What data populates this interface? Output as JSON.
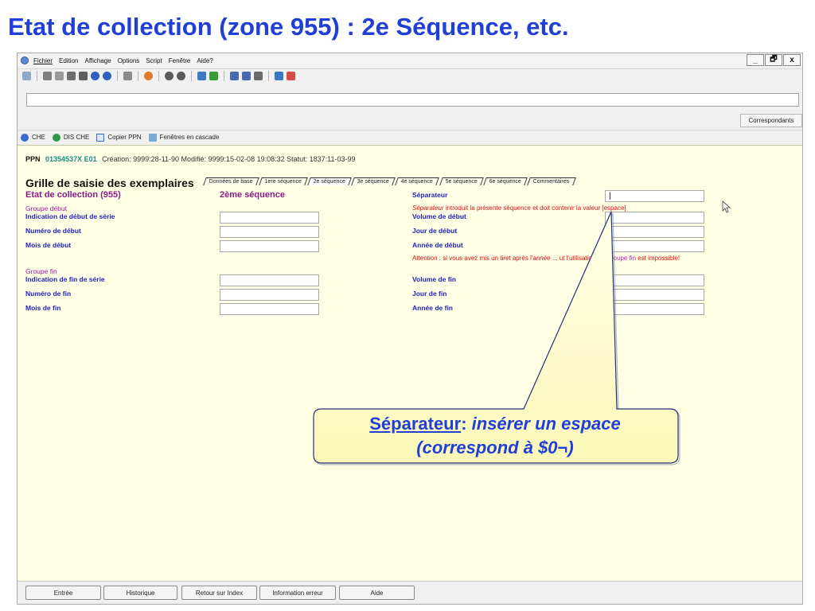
{
  "slide": {
    "title": "Etat de collection (zone 955) :  2e Séquence, etc."
  },
  "menubar": {
    "items": [
      "Fichier",
      "Edition",
      "Affichage",
      "Options",
      "Script",
      "Fenêtre",
      "Aide?"
    ],
    "window_controls": [
      "_",
      "🗗",
      "x"
    ]
  },
  "toolbar": {
    "icons": [
      "print-icon",
      "cut-icon",
      "copy-icon",
      "paste-icon",
      "save-icon",
      "undo-icon",
      "redo-icon",
      "doc-icon",
      "star-icon",
      "back-icon",
      "forward-icon",
      "filter-icon",
      "triangle-icon",
      "code-icon",
      "list-icon",
      "page-icon",
      "upload-icon",
      "arrow-icon"
    ]
  },
  "command_bar": {
    "value": ""
  },
  "correspondants_label": "Correspondants",
  "tabs": [
    {
      "label": "CHE",
      "icon": "help-icon"
    },
    {
      "label": "DIS CHE",
      "icon": "globe-icon"
    },
    {
      "label": "Copier PPN",
      "icon": "check-icon"
    },
    {
      "label": "Fenêtres en cascade",
      "icon": "cascade-icon"
    }
  ],
  "record": {
    "ppn_label": "PPN",
    "ppn_id": "01354537X E01",
    "rest": "Création: 9999:28-11-90 Modifié: 9999:15-02-08 19:08:32 Statut: 1837:11-03-99"
  },
  "form": {
    "title": "Grille de saisie des exemplaires",
    "seq_tabs": [
      "Données de base",
      "1ere séquence",
      "2e séquence",
      "3e séquence",
      "4e séquence",
      "5e séquence",
      "6e séquence",
      "Commentaires"
    ],
    "active_tab": "2e séquence",
    "section_title": "Etat de collection (955)",
    "sequence_title": "2ème séquence",
    "separator_label": "Séparateur",
    "separator_value": "|",
    "separator_note_italic": "Séparateur",
    "separator_note_rest": " introduit la présente séquence et doit contenir la valeur [espace]",
    "groupe_debut": "Groupe début",
    "groupe_fin": "Groupe fin",
    "left_labels_debut": [
      "Indication de début de série",
      "Numéro de début",
      "Mois de début"
    ],
    "right_labels_debut": [
      "Volume de début",
      "Jour de début",
      "Année de début"
    ],
    "left_labels_fin": [
      "Indication de fin de série",
      "Numéro de fin",
      "Mois de fin"
    ],
    "right_labels_fin": [
      "Volume de fin",
      "Jour de fin",
      "Année de fin"
    ],
    "attention_a": "Attention : si vous avez mis un tiret après l'",
    "attention_year": "année",
    "attention_b": " ... ",
    "attention_c": "ut l'utilisation du ",
    "attention_groupe": "Groupe fin",
    "attention_d": " est impossible!"
  },
  "bottom_buttons": [
    "Entrée",
    "Historique",
    "Retour sur Index",
    "Information erreur",
    "Aide"
  ],
  "callout": {
    "underline_part": "Séparateur",
    "colon": ": ",
    "italic_part": "insérer un espace",
    "line2": "(correspond à $0¬)"
  }
}
